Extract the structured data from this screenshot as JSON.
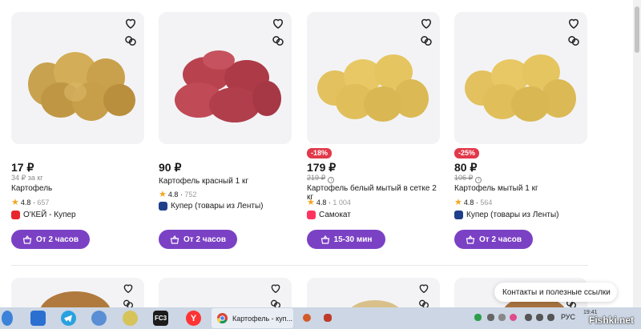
{
  "products": [
    {
      "badge": "",
      "price": "17 ₽",
      "unit_price": "34 ₽ за кг",
      "old_price": "",
      "name": "Картофель",
      "rating": "4.8",
      "reviews": "657",
      "shop": "О'КЕЙ - Купер",
      "shop_logo_color": "#e8262e",
      "delivery": "От 2 часов"
    },
    {
      "badge": "",
      "price": "90 ₽",
      "unit_price": "",
      "old_price": "",
      "name": "Картофель красный 1 кг",
      "rating": "4.8",
      "reviews": "752",
      "shop": "Купер (товары из Ленты)",
      "shop_logo_color": "#1f3f8a",
      "delivery": "От 2 часов"
    },
    {
      "badge": "-18%",
      "price": "179 ₽",
      "unit_price": "",
      "old_price": "219 ₽",
      "name": "Картофель белый мытый в сетке 2 кг",
      "rating": "4.8",
      "reviews": "1 004",
      "shop": "Самокат",
      "shop_logo_color": "#ff335f",
      "delivery": "15-30 мин"
    },
    {
      "badge": "-25%",
      "price": "80 ₽",
      "unit_price": "",
      "old_price": "106 ₽",
      "name": "Картофель мытый 1 кг",
      "rating": "4.8",
      "reviews": "564",
      "shop": "Купер (товары из Ленты)",
      "shop_logo_color": "#1f3f8a",
      "delivery": "От 2 часов"
    }
  ],
  "contacts_chip": "Контакты и полезные ссылки",
  "taskbar": {
    "active_tab_label": "Картофель - куп...",
    "fc3_label": "FC3",
    "lang": "РУС",
    "time": "19:41"
  },
  "watermark": "Fishki.net",
  "colors": {
    "accent": "#7b41c4",
    "discount": "#e2394a",
    "star": "#f5a623"
  }
}
